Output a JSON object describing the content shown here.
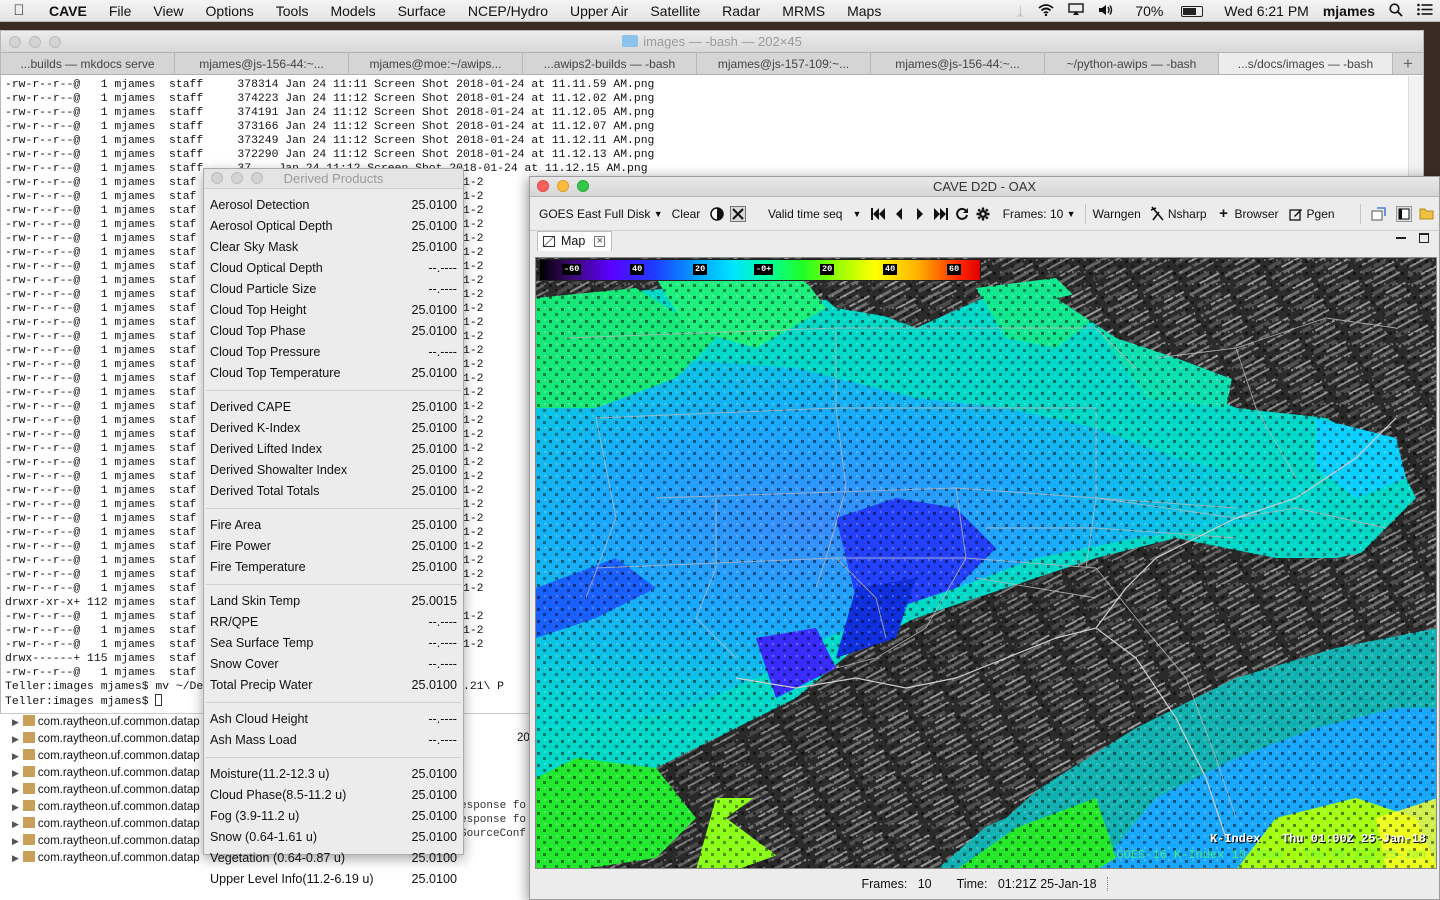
{
  "menubar": {
    "app": "CAVE",
    "items": [
      "File",
      "View",
      "Options",
      "Tools",
      "Models",
      "Surface",
      "NCEP/Hydro",
      "Upper Air",
      "Satellite",
      "Radar",
      "MRMS",
      "Maps"
    ],
    "battery": "70%",
    "battery_level": 0.7,
    "clock": "Wed 6:21 PM",
    "user": "mjames"
  },
  "terminal": {
    "title": "images — -bash — 202×45",
    "tabs": [
      "...builds — mkdocs serve",
      "mjames@js-156-44:~...",
      "mjames@moe:~/awips...",
      "...awips2-builds — -bash",
      "mjames@js-157-109:~...",
      "mjames@js-156-44:~...",
      "~/python-awips — -bash",
      "...s/docs/images — -bash"
    ],
    "active_tab": 7,
    "add_tab": "+",
    "full_lines": [
      "-rw-r--r--@   1 mjames  staff     378314 Jan 24 11:11 Screen Shot 2018-01-24 at 11.11.59 AM.png",
      "-rw-r--r--@   1 mjames  staff     374223 Jan 24 11:12 Screen Shot 2018-01-24 at 11.12.02 AM.png",
      "-rw-r--r--@   1 mjames  staff     374191 Jan 24 11:12 Screen Shot 2018-01-24 at 11.12.05 AM.png",
      "-rw-r--r--@   1 mjames  staff     373166 Jan 24 11:12 Screen Shot 2018-01-24 at 11.12.07 AM.png",
      "-rw-r--r--@   1 mjames  staff     373249 Jan 24 11:12 Screen Shot 2018-01-24 at 11.12.11 AM.png",
      "-rw-r--r--@   1 mjames  staff     372290 Jan 24 11:12 Screen Shot 2018-01-24 at 11.12.13 AM.png",
      "-rw-r--r--@   1 mjames  staff     37    Jan 24 11:12 Screen Shot 2018-01-24 at 11.12.15 AM.png"
    ],
    "partial_lines": [
      "-rw-r--r--@   1 mjames  staf                                 2018-01-2",
      "-rw-r--r--@   1 mjames  staf                                 2018-01-2",
      "-rw-r--r--@   1 mjames  staf                                 2018-01-2",
      "-rw-r--r--@   1 mjames  staf                                 2018-01-2",
      "-rw-r--r--@   1 mjames  staf                                 2018-01-2",
      "-rw-r--r--@   1 mjames  staf                                 2018-01-2",
      "-rw-r--r--@   1 mjames  staf                                 2018-01-2",
      "-rw-r--r--@   1 mjames  staf                                 2018-01-2",
      "-rw-r--r--@   1 mjames  staf                                 2018-01-2",
      "-rw-r--r--@   1 mjames  staf                                 2018-01-2",
      "-rw-r--r--@   1 mjames  staf                                 2018-01-2",
      "-rw-r--r--@   1 mjames  staf                                 2018-01-2",
      "-rw-r--r--@   1 mjames  staf                                 2018-01-2",
      "-rw-r--r--@   1 mjames  staf                                 2018-01-2",
      "-rw-r--r--@   1 mjames  staf                                 2018-01-2",
      "-rw-r--r--@   1 mjames  staf                                 2018-01-2",
      "-rw-r--r--@   1 mjames  staf                                 2018-01-2",
      "-rw-r--r--@   1 mjames  staf                                 2018-01-2",
      "-rw-r--r--@   1 mjames  staf                                 2018-01-2",
      "-rw-r--r--@   1 mjames  staf                                 2018-01-2",
      "-rw-r--r--@   1 mjames  staf                                 2018-01-2",
      "-rw-r--r--@   1 mjames  staf                                 2018-01-2",
      "-rw-r--r--@   1 mjames  staf                                 2018-01-2",
      "-rw-r--r--@   1 mjames  staf                                 2018-01-2",
      "-rw-r--r--@   1 mjames  staf                                 2018-01-2",
      "-rw-r--r--@   1 mjames  staf                                 2018-01-2",
      "-rw-r--r--@   1 mjames  staf                                 2018-01-2",
      "-rw-r--r--@   1 mjames  staf                                 2018-01-2",
      "-rw-r--r--@   1 mjames  staf                                 2018-01-2",
      "-rw-r--r--@   1 mjames  staf                                 2018-01-2",
      "drwxr-xr-x+ 112 mjames  staf",
      "-rw-r--r--@   1 mjames  staf                                 2018-01-2",
      "-rw-r--r--@   1 mjames  staf                                 2018-01-2",
      "-rw-r--r--@   1 mjames  staf                                 2018-01-2",
      "drwx------+ 115 mjames  staf",
      "-rw-r--r--@   1 mjames  staf"
    ],
    "prompt1": "Teller:images mjames$ mv ~/De                                  5.19.21\\ P",
    "prompt2": "Teller:images mjames$ "
  },
  "tree": {
    "rows": [
      "com.raytheon.uf.common.datap",
      "com.raytheon.uf.common.datap",
      "com.raytheon.uf.common.datap",
      "com.raytheon.uf.common.datap",
      "com.raytheon.uf.common.datap",
      "com.raytheon.uf.common.datap",
      "com.raytheon.uf.common.datap",
      "com.raytheon.uf.common.datap",
      "com.raytheon.uf.common.datap"
    ],
    "number": "20",
    "side_text": "esponse fo\nesponse fo\nSourceConf"
  },
  "derived_products": {
    "title": "Derived Products",
    "groups": [
      [
        {
          "label": "Aerosol Detection",
          "value": "25.0100"
        },
        {
          "label": "Aerosol Optical Depth",
          "value": "25.0100"
        },
        {
          "label": "Clear Sky Mask",
          "value": "25.0100"
        },
        {
          "label": "Cloud Optical Depth",
          "value": "--.----"
        },
        {
          "label": "Cloud Particle Size",
          "value": "--.----"
        },
        {
          "label": "Cloud Top Height",
          "value": "25.0100"
        },
        {
          "label": "Cloud Top Phase",
          "value": "25.0100"
        },
        {
          "label": "Cloud Top Pressure",
          "value": "--.----"
        },
        {
          "label": "Cloud Top Temperature",
          "value": "25.0100"
        }
      ],
      [
        {
          "label": "Derived CAPE",
          "value": "25.0100"
        },
        {
          "label": "Derived K-Index",
          "value": "25.0100"
        },
        {
          "label": "Derived Lifted Index",
          "value": "25.0100"
        },
        {
          "label": "Derived Showalter Index",
          "value": "25.0100"
        },
        {
          "label": "Derived Total Totals",
          "value": "25.0100"
        }
      ],
      [
        {
          "label": "Fire Area",
          "value": "25.0100"
        },
        {
          "label": "Fire Power",
          "value": "25.0100"
        },
        {
          "label": "Fire Temperature",
          "value": "25.0100"
        }
      ],
      [
        {
          "label": "Land Skin Temp",
          "value": "25.0015"
        },
        {
          "label": "RR/QPE",
          "value": "--.----"
        },
        {
          "label": "Sea Surface Temp",
          "value": "--.----"
        },
        {
          "label": "Snow Cover",
          "value": "--.----"
        },
        {
          "label": "Total Precip Water",
          "value": "25.0100"
        }
      ],
      [
        {
          "label": "Ash Cloud Height",
          "value": "--.----"
        },
        {
          "label": "Ash Mass Load",
          "value": "--.----"
        }
      ],
      [
        {
          "label": "Moisture(11.2-12.3 u)",
          "value": "25.0100"
        },
        {
          "label": "Cloud Phase(8.5-11.2 u)",
          "value": "25.0100"
        },
        {
          "label": "Fog (3.9-11.2 u)",
          "value": "25.0100"
        },
        {
          "label": "Snow (0.64-1.61 u)",
          "value": "25.0100"
        },
        {
          "label": "Vegetation (0.64-0.87 u)",
          "value": "25.0100"
        },
        {
          "label": "Upper Level Info(11.2-6.19 u)",
          "value": "25.0100"
        }
      ]
    ]
  },
  "cave": {
    "title": "CAVE D2D - OAX",
    "toolbar": {
      "projection": "GOES East Full Disk",
      "clear": "Clear",
      "loop_mode": "Valid time seq",
      "frames_label": "Frames: 10",
      "warngen": "Warngen",
      "nsharp": "Nsharp",
      "browser": "Browser",
      "pgen": "Pgen"
    },
    "tab_label": "Map",
    "colorbar_labels": [
      "-60",
      "40",
      "20",
      "-0+",
      "20",
      "40",
      "60"
    ],
    "readout_line1": "K-Index   Thu 01:00Z 25-Jan-18",
    "readout_line2": "GOES-16 K-Index 10.35um   Thu 01:21Z 25-Jan",
    "status": {
      "frames_label": "Frames:",
      "frames_value": "10",
      "time_label": "Time:",
      "time_value": "01:21Z 25-Jan-18"
    }
  },
  "colors": {
    "red_light": "#fc605c",
    "yellow_light": "#fdbc40",
    "green_light": "#34c84a"
  }
}
